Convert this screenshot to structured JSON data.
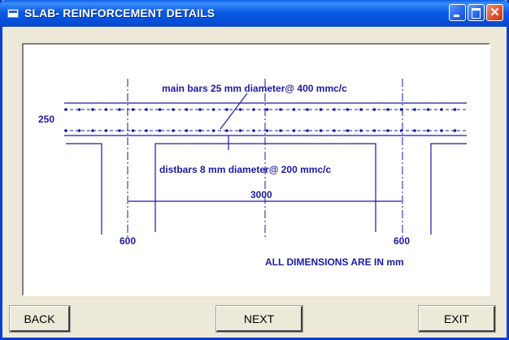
{
  "window": {
    "title": "SLAB- REINFORCEMENT DETAILS"
  },
  "drawing": {
    "main_bars_label": "main bars 25 mm diameter@ 400 mmc/c",
    "dist_bars_label": "distbars 8 mm diameter@ 200 mmc/c",
    "thickness_label": "250",
    "span_label": "3000",
    "left_support_label": "600",
    "right_support_label": "600",
    "units_note": "ALL DIMENSIONS ARE IN mm",
    "line_color": "#1a1aa6"
  },
  "buttons": {
    "back": "BACK",
    "next": "NEXT",
    "exit": "EXIT"
  }
}
